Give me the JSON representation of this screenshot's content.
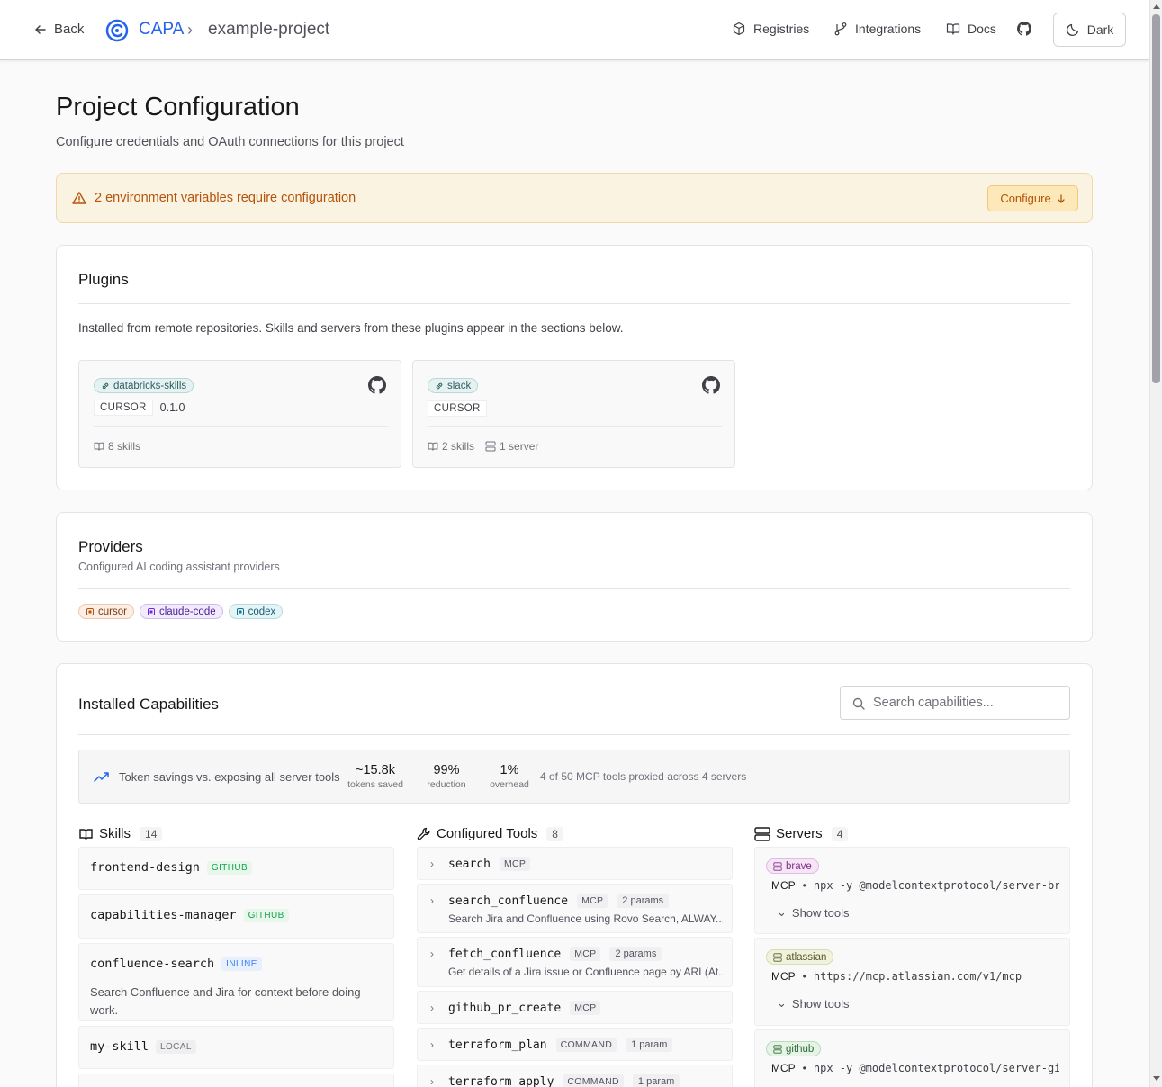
{
  "header": {
    "back_label": "Back",
    "brand": "CAPA",
    "project": "example-project",
    "nav": {
      "registries": "Registries",
      "integrations": "Integrations",
      "docs": "Docs"
    },
    "theme_label": "Dark"
  },
  "page": {
    "title": "Project Configuration",
    "subtitle": "Configure credentials and OAuth connections for this project"
  },
  "alert": {
    "text": "2 environment variables require configuration",
    "button": "Configure"
  },
  "plugins": {
    "title": "Plugins",
    "description": "Installed from remote repositories. Skills and servers from these plugins appear in the sections below.",
    "items": [
      {
        "name": "databricks-skills",
        "provider": "CURSOR",
        "version": "0.1.0",
        "skills": "8 skills",
        "servers": ""
      },
      {
        "name": "slack",
        "provider": "CURSOR",
        "version": "",
        "skills": "2 skills",
        "servers": "1 server"
      }
    ]
  },
  "providers": {
    "title": "Providers",
    "subtitle": "Configured AI coding assistant providers",
    "items": [
      {
        "name": "cursor",
        "color": "#b45309"
      },
      {
        "name": "claude-code",
        "color": "#6d28d9"
      },
      {
        "name": "codex",
        "color": "#0e7490"
      }
    ]
  },
  "capabilities": {
    "title": "Installed Capabilities",
    "search_placeholder": "Search capabilities...",
    "stats": {
      "label": "Token savings vs. exposing all server tools",
      "tokens_saved": "~15.8k",
      "tokens_saved_label": "tokens saved",
      "reduction": "99%",
      "reduction_label": "reduction",
      "overhead": "1%",
      "overhead_label": "overhead",
      "summary": "4 of 50 MCP tools proxied across 4 servers"
    },
    "skills": {
      "title": "Skills",
      "count": "14",
      "items": [
        {
          "name": "frontend-design",
          "source": "GITHUB",
          "description": ""
        },
        {
          "name": "capabilities-manager",
          "source": "GITHUB",
          "description": ""
        },
        {
          "name": "confluence-search",
          "source": "INLINE",
          "description": "Search Confluence and Jira for context before doing work."
        },
        {
          "name": "my-skill",
          "source": "LOCAL",
          "description": ""
        }
      ]
    },
    "tools": {
      "title": "Configured Tools",
      "count": "8",
      "items": [
        {
          "name": "search",
          "type": "MCP",
          "params": "",
          "description": ""
        },
        {
          "name": "search_confluence",
          "type": "MCP",
          "params": "2 params",
          "description": "Search Jira and Confluence using Rovo Search, ALWAY..."
        },
        {
          "name": "fetch_confluence",
          "type": "MCP",
          "params": "2 params",
          "description": "Get details of a Jira issue or Confluence page by ARI (At..."
        },
        {
          "name": "github_pr_create",
          "type": "MCP",
          "params": "",
          "description": ""
        },
        {
          "name": "terraform_plan",
          "type": "COMMAND",
          "params": "1 param",
          "description": ""
        },
        {
          "name": "terraform_apply",
          "type": "COMMAND",
          "params": "1 param",
          "description": ""
        }
      ]
    },
    "servers": {
      "title": "Servers",
      "count": "4",
      "show_tools": "Show tools",
      "items": [
        {
          "name": "brave",
          "kind": "MCP",
          "command": "npx -y @modelcontextprotocol/server-bra..."
        },
        {
          "name": "atlassian",
          "kind": "MCP",
          "command": "https://mcp.atlassian.com/v1/mcp"
        },
        {
          "name": "github",
          "kind": "MCP",
          "command": "npx -y @modelcontextprotocol/server-git..."
        }
      ]
    }
  }
}
